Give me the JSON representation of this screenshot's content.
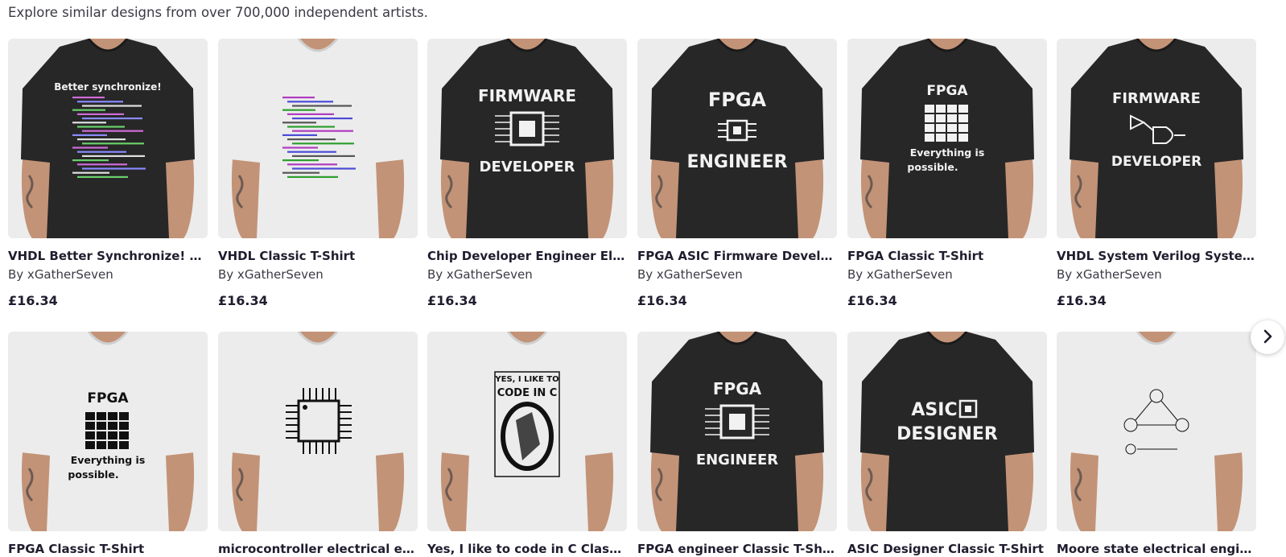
{
  "intro_text": "Explore similar designs from over 700,000 independent artists.",
  "rows": [
    [
      {
        "title": "VHDL Better Synchronize! Classi...",
        "artist": "By xGatherSeven",
        "price": "£16.34",
        "shirt_color": "#272727",
        "design": "code",
        "design_text": [
          "Better synchronize!"
        ]
      },
      {
        "title": "VHDL Classic T-Shirt",
        "artist": "By xGatherSeven",
        "price": "£16.34",
        "shirt_color": "#ececec",
        "design": "code-light",
        "design_text": []
      },
      {
        "title": "Chip Developer Engineer Electric...",
        "artist": "By xGatherSeven",
        "price": "£16.34",
        "shirt_color": "#272727",
        "design": "chip",
        "design_text": [
          "FIRMWARE",
          "DEVELOPER"
        ]
      },
      {
        "title": "FPGA ASIC Firmware Developer ...",
        "artist": "By xGatherSeven",
        "price": "£16.34",
        "shirt_color": "#272727",
        "design": "small-chip",
        "design_text": [
          "FPGA",
          "ENGINEER"
        ]
      },
      {
        "title": "FPGA Classic T-Shirt",
        "artist": "By xGatherSeven",
        "price": "£16.34",
        "shirt_color": "#272727",
        "design": "grid",
        "design_text": [
          "FPGA",
          "Everything is",
          "possible."
        ]
      },
      {
        "title": "VHDL System Verilog SystemC ...",
        "artist": "By xGatherSeven",
        "price": "£16.34",
        "shirt_color": "#272727",
        "design": "gates",
        "design_text": [
          "FIRMWARE",
          "DEVELOPER"
        ]
      }
    ],
    [
      {
        "title": "FPGA Classic T-Shirt",
        "artist": "",
        "price": "",
        "shirt_color": "#ececec",
        "design": "grid-dark",
        "design_text": [
          "FPGA",
          "Everything is",
          "possible."
        ]
      },
      {
        "title": "microcontroller electrical engi...",
        "artist": "",
        "price": "",
        "shirt_color": "#ececec",
        "design": "mcu",
        "design_text": []
      },
      {
        "title": "Yes, I like to code in C Classic T...",
        "artist": "",
        "price": "",
        "shirt_color": "#ececec",
        "design": "poster",
        "design_text": [
          "YES, I LIKE TO",
          "CODE IN C"
        ]
      },
      {
        "title": "FPGA engineer Classic T-Shirt",
        "artist": "",
        "price": "",
        "shirt_color": "#272727",
        "design": "chip",
        "design_text": [
          "FPGA",
          "ENGINEER"
        ]
      },
      {
        "title": "ASIC Designer Classic T-Shirt",
        "artist": "",
        "price": "",
        "shirt_color": "#272727",
        "design": "asic",
        "design_text": [
          "ASIC",
          "DESIGNER"
        ]
      },
      {
        "title": "Moore state electrical engineeri...",
        "artist": "",
        "price": "",
        "shirt_color": "#ececec",
        "design": "fsm",
        "design_text": []
      }
    ]
  ],
  "next_button": {
    "icon": "chevron-right-icon"
  }
}
